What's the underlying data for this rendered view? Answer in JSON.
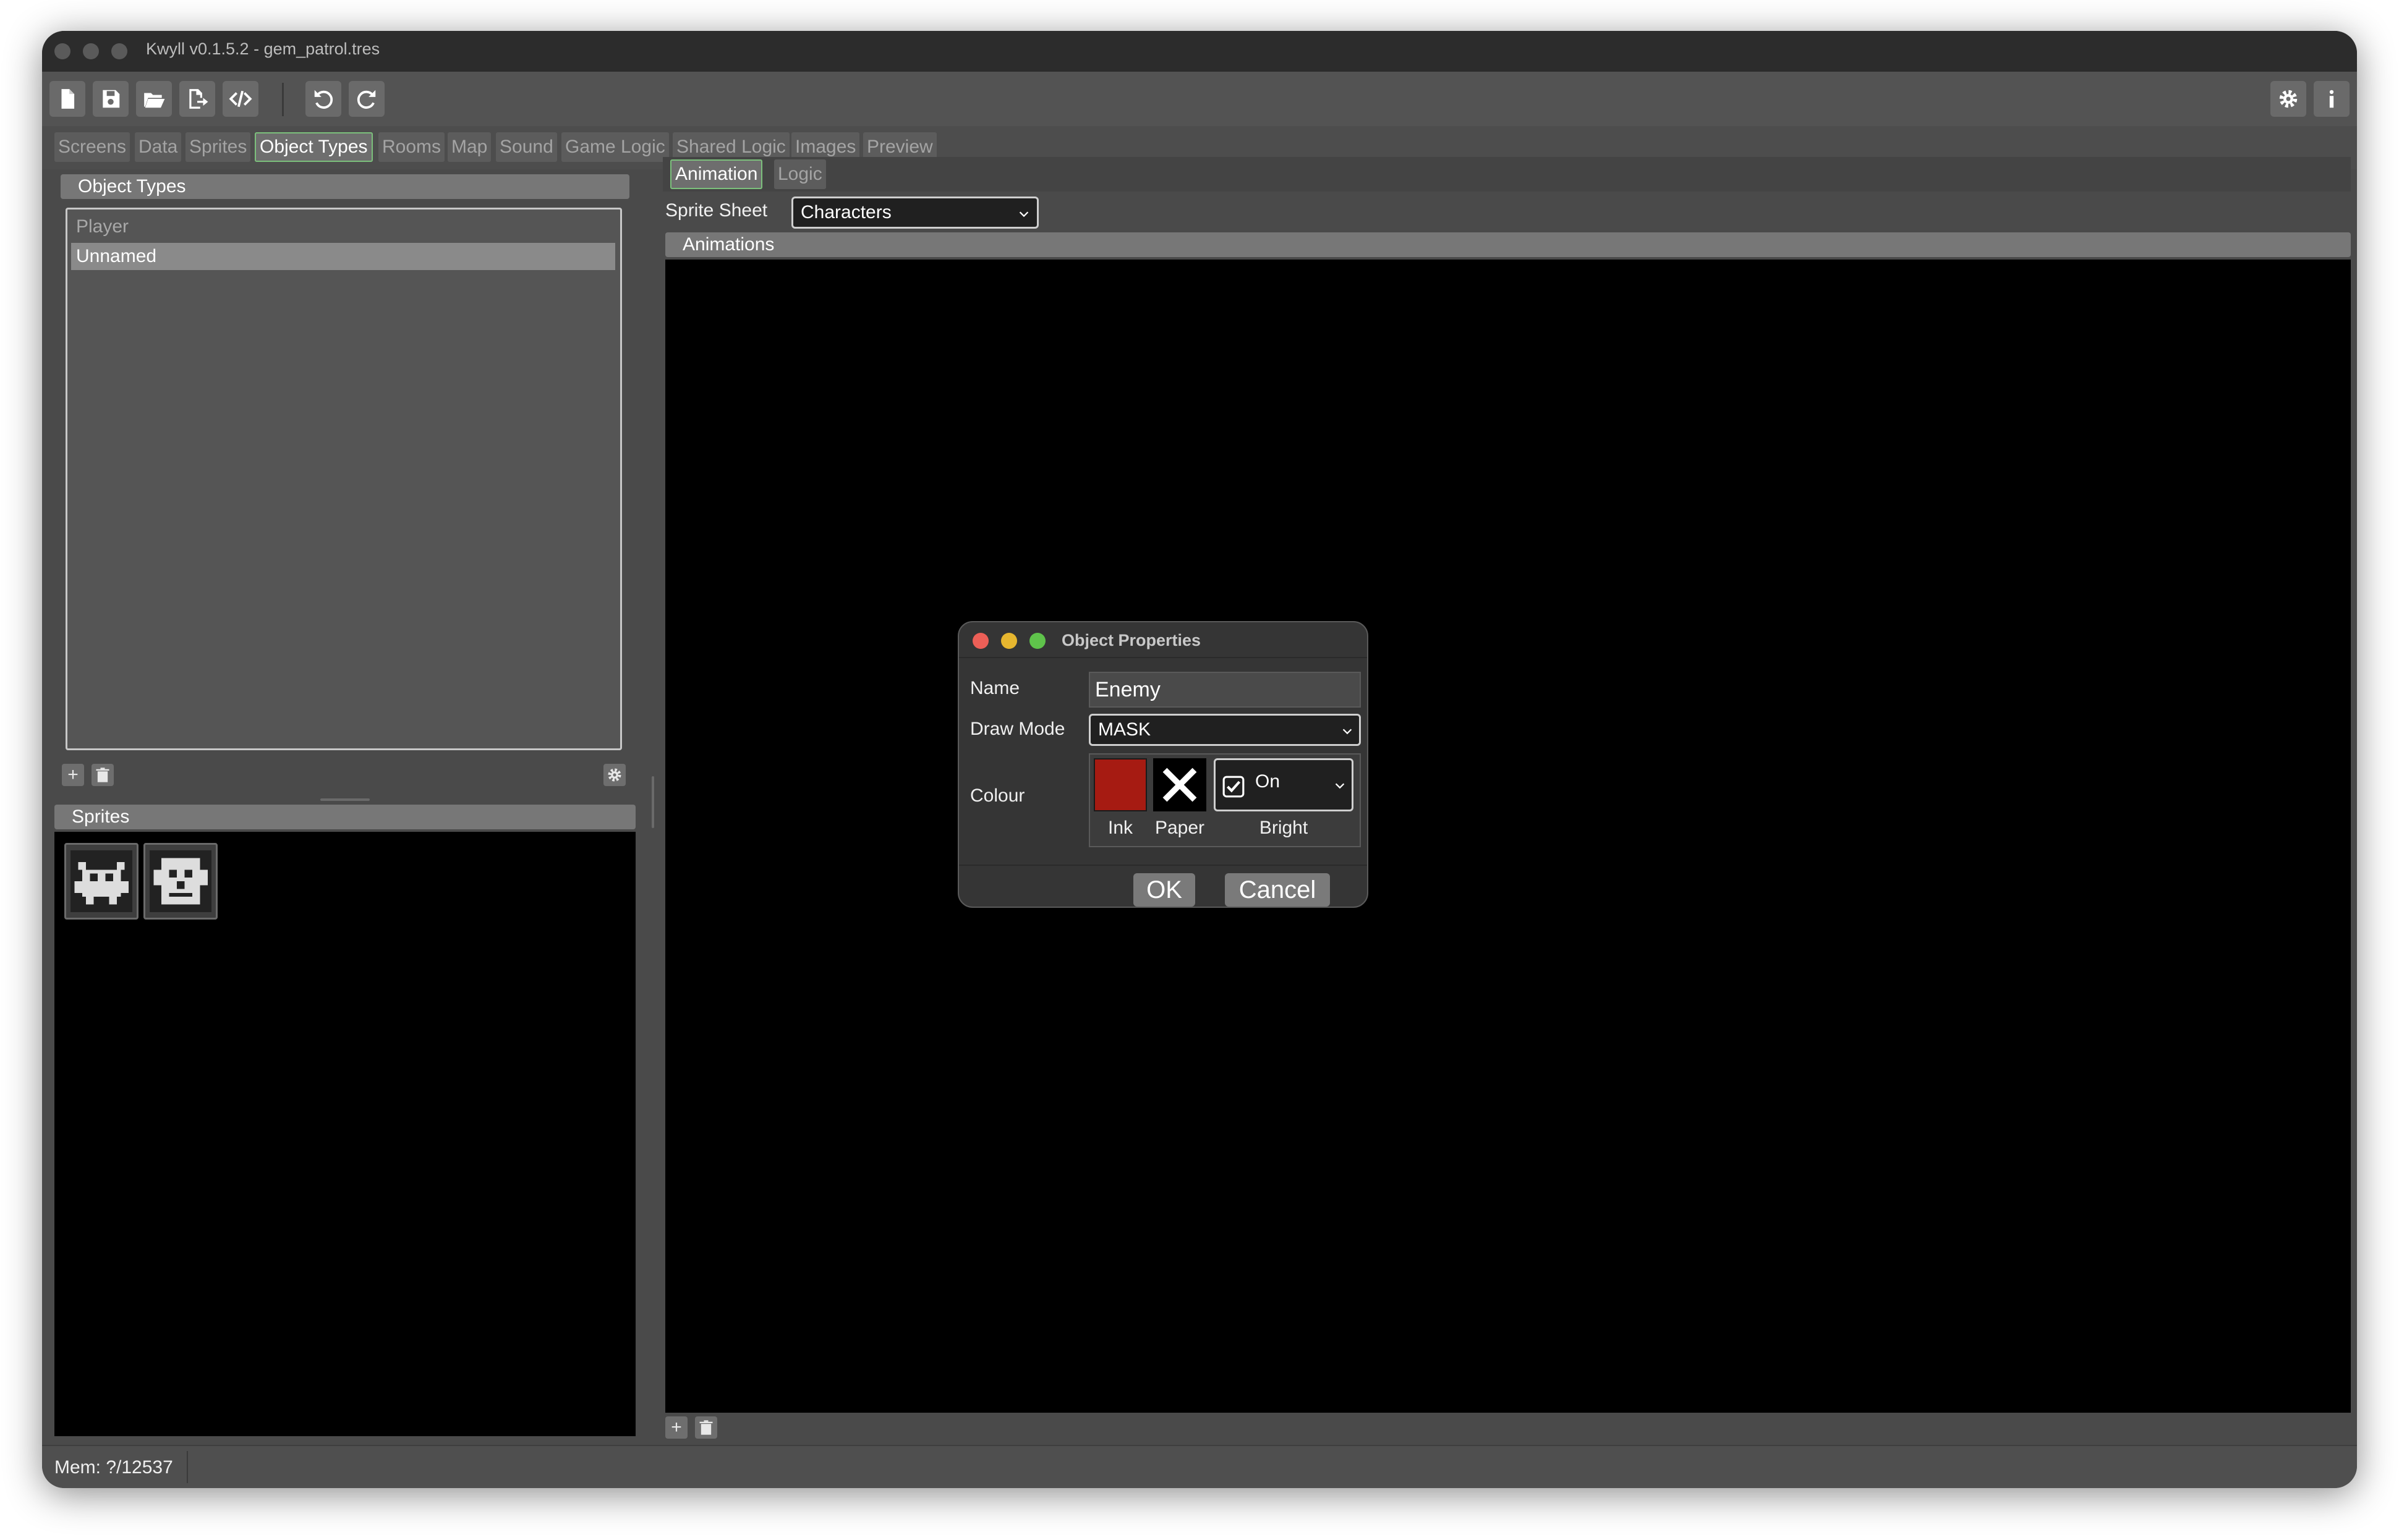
{
  "window": {
    "title": "Kwyll v0.1.5.2 - gem_patrol.tres"
  },
  "toolbar": {
    "buttons": [
      "new-file-icon",
      "save-icon",
      "open-folder-icon",
      "export-icon",
      "code-icon",
      "undo-icon",
      "redo-icon"
    ],
    "right_buttons": [
      "gear-icon",
      "info-icon"
    ]
  },
  "tabs": [
    "Screens",
    "Data",
    "Sprites",
    "Object Types",
    "Rooms",
    "Map",
    "Sound",
    "Game Logic",
    "Shared Logic",
    "Images",
    "Preview"
  ],
  "active_tab": "Object Types",
  "object_types_panel": {
    "title": "Object Types",
    "items": [
      "Player",
      "Unnamed"
    ],
    "selected": "Unnamed"
  },
  "sprites_panel": {
    "title": "Sprites",
    "thumbnails": [
      "crab-sprite",
      "robot-face-sprite"
    ]
  },
  "sub_tabs": [
    "Animation",
    "Logic"
  ],
  "active_sub_tab": "Animation",
  "sprite_sheet": {
    "label": "Sprite Sheet",
    "value": "Characters"
  },
  "animations_header": "Animations",
  "dialog": {
    "title": "Object Properties",
    "name_label": "Name",
    "name_value": "Enemy",
    "draw_mode_label": "Draw Mode",
    "draw_mode_value": "MASK",
    "colour_label": "Colour",
    "ink_label": "Ink",
    "paper_label": "Paper",
    "bright_label": "Bright",
    "bright_value": "On",
    "ink_color": "#a61b12",
    "ok_label": "OK",
    "cancel_label": "Cancel"
  },
  "status": {
    "memory": "Mem: ?/12537"
  }
}
